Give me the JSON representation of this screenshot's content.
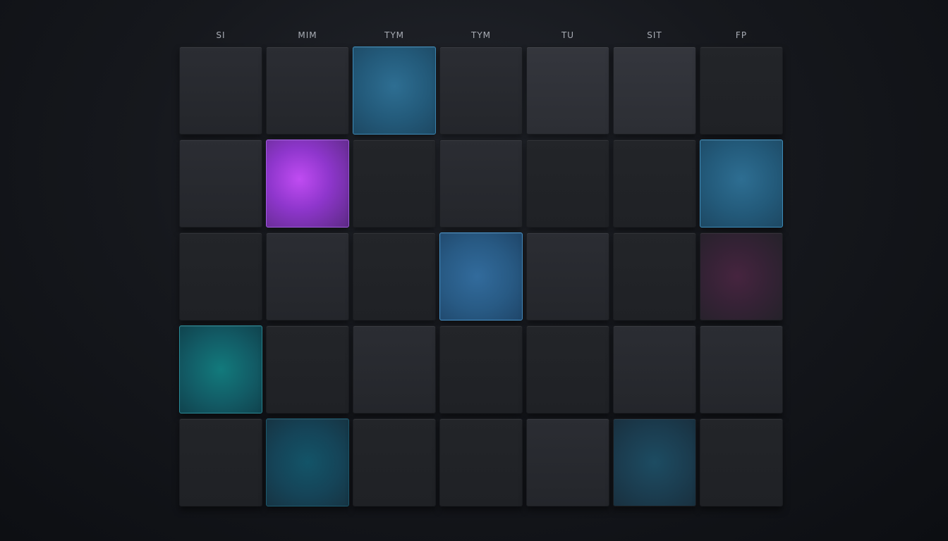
{
  "calendar": {
    "day_headers": [
      "SI",
      "MIM",
      "TYM",
      "TYM",
      "TU",
      "SIT",
      "FP"
    ],
    "rows": [
      [
        {
          "state": "empty",
          "tone": "default"
        },
        {
          "state": "empty",
          "tone": "default"
        },
        {
          "state": "highlighted",
          "tone": "blue",
          "color": "#2e6e92"
        },
        {
          "state": "empty",
          "tone": "default"
        },
        {
          "state": "empty",
          "tone": "light"
        },
        {
          "state": "empty",
          "tone": "light"
        },
        {
          "state": "empty",
          "tone": "dark"
        }
      ],
      [
        {
          "state": "empty",
          "tone": "default"
        },
        {
          "state": "selected",
          "tone": "purple",
          "color": "#c04cf2"
        },
        {
          "state": "empty",
          "tone": "dark"
        },
        {
          "state": "empty",
          "tone": "default"
        },
        {
          "state": "empty",
          "tone": "dark"
        },
        {
          "state": "empty",
          "tone": "dark"
        },
        {
          "state": "highlighted",
          "tone": "blue",
          "color": "#2e6e92"
        }
      ],
      [
        {
          "state": "empty",
          "tone": "dark"
        },
        {
          "state": "empty",
          "tone": "default"
        },
        {
          "state": "empty",
          "tone": "dark"
        },
        {
          "state": "highlighted",
          "tone": "blue-med",
          "color": "#326b9c"
        },
        {
          "state": "empty",
          "tone": "default"
        },
        {
          "state": "empty",
          "tone": "dark"
        },
        {
          "state": "highlighted",
          "tone": "plum",
          "color": "#46243f"
        }
      ],
      [
        {
          "state": "highlighted",
          "tone": "teal",
          "color": "#127a7c"
        },
        {
          "state": "empty",
          "tone": "dark"
        },
        {
          "state": "empty",
          "tone": "default"
        },
        {
          "state": "empty",
          "tone": "dark"
        },
        {
          "state": "empty",
          "tone": "dark"
        },
        {
          "state": "empty",
          "tone": "default"
        },
        {
          "state": "empty",
          "tone": "default"
        }
      ],
      [
        {
          "state": "empty",
          "tone": "dark"
        },
        {
          "state": "highlighted",
          "tone": "deep-teal",
          "color": "#135468"
        },
        {
          "state": "empty",
          "tone": "dark"
        },
        {
          "state": "empty",
          "tone": "dark"
        },
        {
          "state": "empty",
          "tone": "default"
        },
        {
          "state": "highlighted",
          "tone": "steel",
          "color": "#1d4c62"
        },
        {
          "state": "empty",
          "tone": "dark"
        }
      ]
    ]
  },
  "colors": {
    "background": "#16181d",
    "tile": "#2b2d33",
    "label": "#a9adb5",
    "accent_purple": "#c04cf2",
    "accent_blue": "#2e6e92",
    "accent_teal": "#127a7c"
  }
}
